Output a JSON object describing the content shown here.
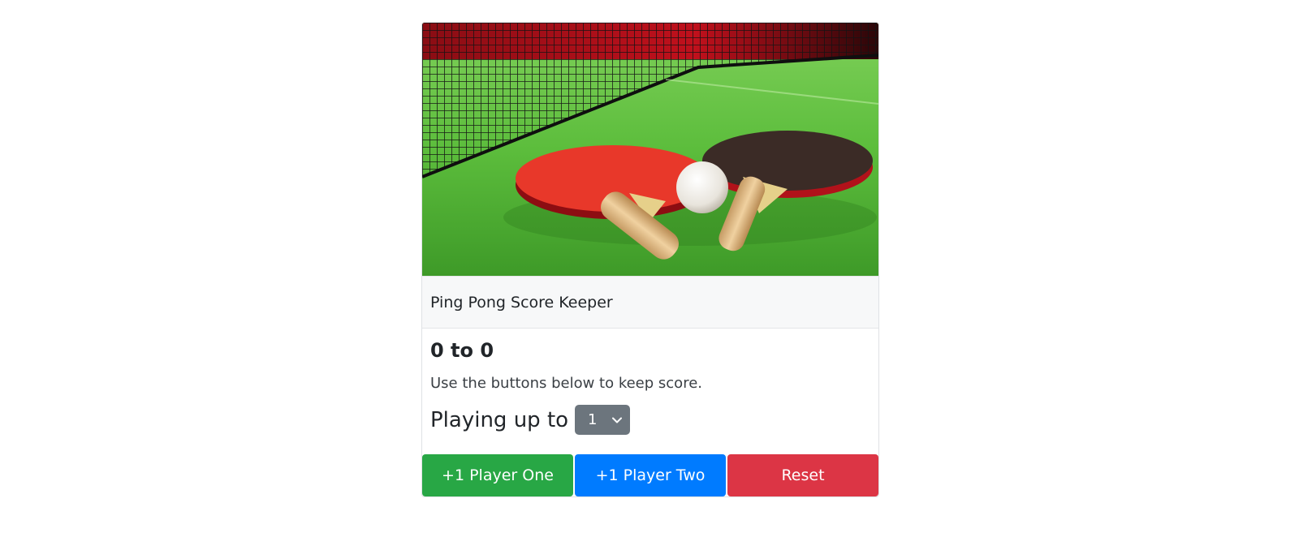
{
  "card": {
    "image_icon": "ping-pong-paddles-photo",
    "header_title": "Ping Pong Score Keeper",
    "score_text": "0 to 0",
    "hint_text": "Use the buttons below to keep score.",
    "playing_label": "Playing up to",
    "select": {
      "value": "1",
      "icon": "chevron-down-icon"
    }
  },
  "buttons": [
    {
      "label": "+1 Player One",
      "color": "#28a745"
    },
    {
      "label": "+1 Player Two",
      "color": "#007bff"
    },
    {
      "label": "Reset",
      "color": "#dc3545"
    }
  ]
}
